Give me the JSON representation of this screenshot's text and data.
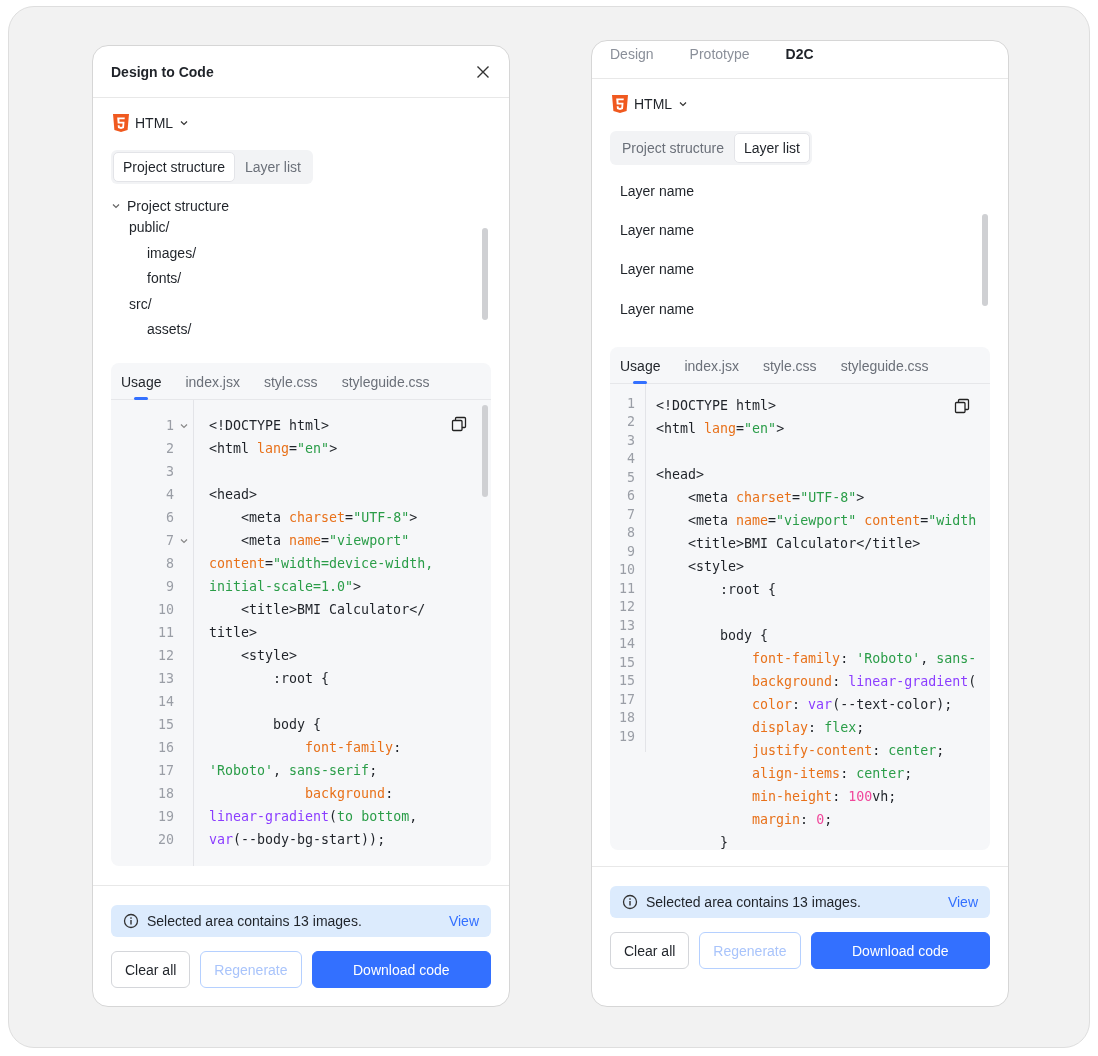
{
  "panels": [
    {
      "kind": "dialog",
      "title": "Design to Code",
      "language": "HTML",
      "segments": [
        {
          "label": "Project structure",
          "selected": true
        },
        {
          "label": "Layer list",
          "selected": false
        }
      ],
      "tree": {
        "label": "Project structure",
        "expanded": true,
        "children": [
          {
            "label": "public/",
            "children": [
              {
                "label": "images/"
              },
              {
                "label": "fonts/"
              }
            ]
          },
          {
            "label": "src/",
            "children": [
              {
                "label": "assets/"
              }
            ]
          }
        ]
      },
      "file_tabs": [
        {
          "label": "Usage",
          "selected": true
        },
        {
          "label": "index.jsx",
          "selected": false
        },
        {
          "label": "style.css",
          "selected": false
        },
        {
          "label": "styleguide.css",
          "selected": false
        }
      ],
      "rows": [
        {
          "number": "1",
          "foldable": true,
          "tokens": [
            {
              "kind": "plain",
              "text": "<!DOCTYPE html>"
            }
          ]
        },
        {
          "number": "2",
          "foldable": false,
          "tokens": [
            {
              "kind": "plain",
              "text": "<html "
            },
            {
              "kind": "attr",
              "text": "lang"
            },
            {
              "kind": "plain",
              "text": "="
            },
            {
              "kind": "string",
              "text": "\"en\""
            },
            {
              "kind": "plain",
              "text": ">"
            }
          ]
        },
        {
          "number": "3",
          "foldable": false
        },
        {
          "number": "4",
          "foldable": false,
          "tokens": [
            {
              "kind": "plain",
              "text": "<head>"
            }
          ]
        },
        {
          "number": "6",
          "foldable": false,
          "tokens": [
            {
              "kind": "plain",
              "text": "    <meta "
            },
            {
              "kind": "attr",
              "text": "charset"
            },
            {
              "kind": "plain",
              "text": "="
            },
            {
              "kind": "string",
              "text": "\"UTF-8\""
            },
            {
              "kind": "plain",
              "text": ">"
            }
          ]
        },
        {
          "number": "7",
          "foldable": true,
          "tokens": [
            {
              "kind": "plain",
              "text": "    <meta "
            },
            {
              "kind": "attr",
              "text": "name"
            },
            {
              "kind": "plain",
              "text": "="
            },
            {
              "kind": "string",
              "text": "\"viewport\""
            }
          ]
        },
        {
          "number": "8",
          "foldable": false,
          "tokens": [
            {
              "kind": "attr",
              "text": "content"
            },
            {
              "kind": "plain",
              "text": "="
            },
            {
              "kind": "string",
              "text": "\"width=device-width,"
            }
          ]
        },
        {
          "number": "9",
          "foldable": false,
          "tokens": [
            {
              "kind": "string",
              "text": "initial-scale=1.0\""
            },
            {
              "kind": "plain",
              "text": ">"
            }
          ]
        },
        {
          "number": "10",
          "foldable": false,
          "tokens": [
            {
              "kind": "plain",
              "text": "    <title>BMI Calculator</"
            }
          ]
        },
        {
          "number": "11",
          "foldable": false,
          "tokens": [
            {
              "kind": "plain",
              "text": "title>"
            }
          ]
        },
        {
          "number": "12",
          "foldable": false,
          "tokens": [
            {
              "kind": "plain",
              "text": "    <style>"
            }
          ]
        },
        {
          "number": "13",
          "foldable": false,
          "tokens": [
            {
              "kind": "plain",
              "text": "        :root {"
            }
          ]
        },
        {
          "number": "14",
          "foldable": false
        },
        {
          "number": "15",
          "foldable": false,
          "tokens": [
            {
              "kind": "plain",
              "text": "        body {"
            }
          ]
        },
        {
          "number": "16",
          "foldable": false,
          "tokens": [
            {
              "kind": "attr",
              "text": "            font-family"
            },
            {
              "kind": "plain",
              "text": ":"
            }
          ]
        },
        {
          "number": "17",
          "foldable": false,
          "tokens": [
            {
              "kind": "string",
              "text": "'Roboto'"
            },
            {
              "kind": "plain",
              "text": ", "
            },
            {
              "kind": "string",
              "text": "sans-serif"
            },
            {
              "kind": "plain",
              "text": ";"
            }
          ]
        },
        {
          "number": "18",
          "foldable": false,
          "tokens": [
            {
              "kind": "attr",
              "text": "            background"
            },
            {
              "kind": "plain",
              "text": ":"
            }
          ]
        },
        {
          "number": "19",
          "foldable": false,
          "tokens": [
            {
              "kind": "func",
              "text": "linear-gradient"
            },
            {
              "kind": "plain",
              "text": "("
            },
            {
              "kind": "string",
              "text": "to bottom"
            },
            {
              "kind": "plain",
              "text": ","
            }
          ]
        },
        {
          "number": "20",
          "foldable": false,
          "tokens": [
            {
              "kind": "func",
              "text": "var"
            },
            {
              "kind": "plain",
              "text": "(--body-bg-start));"
            }
          ]
        }
      ],
      "notice": {
        "text": "Selected area contains 13 images.",
        "link": "View"
      },
      "buttons": [
        {
          "label": "Clear all",
          "kind": "secondary",
          "disabled": false
        },
        {
          "label": "Regenerate",
          "kind": "secondary",
          "disabled": true
        },
        {
          "label": "Download code",
          "kind": "primary",
          "disabled": false
        }
      ]
    },
    {
      "kind": "sidebar",
      "tabs": [
        {
          "label": "Design",
          "selected": false
        },
        {
          "label": "Prototype",
          "selected": false
        },
        {
          "label": "D2C",
          "selected": true
        }
      ],
      "language": "HTML",
      "segments": [
        {
          "label": "Project structure",
          "selected": false
        },
        {
          "label": "Layer list",
          "selected": true
        }
      ],
      "layers": [
        "Layer name",
        "Layer name",
        "Layer name",
        "Layer name"
      ],
      "file_tabs": [
        {
          "label": "Usage",
          "selected": true
        },
        {
          "label": "index.jsx",
          "selected": false
        },
        {
          "label": "style.css",
          "selected": false
        },
        {
          "label": "styleguide.css",
          "selected": false
        }
      ],
      "rows": [
        {
          "number": "1",
          "tokens": [
            {
              "kind": "plain",
              "text": "<!DOCTYPE html>"
            }
          ]
        },
        {
          "number": "2",
          "tokens": [
            {
              "kind": "plain",
              "text": "<html "
            },
            {
              "kind": "attr",
              "text": "lang"
            },
            {
              "kind": "plain",
              "text": "="
            },
            {
              "kind": "string",
              "text": "\"en\""
            },
            {
              "kind": "plain",
              "text": ">"
            }
          ]
        },
        {
          "number": "3"
        },
        {
          "number": "4",
          "tokens": [
            {
              "kind": "plain",
              "text": "<head>"
            }
          ]
        },
        {
          "number": "5",
          "tokens": [
            {
              "kind": "plain",
              "text": "    <meta "
            },
            {
              "kind": "attr",
              "text": "charset"
            },
            {
              "kind": "plain",
              "text": "="
            },
            {
              "kind": "string",
              "text": "\"UTF-8\""
            },
            {
              "kind": "plain",
              "text": ">"
            }
          ]
        },
        {
          "number": "6",
          "tokens": [
            {
              "kind": "plain",
              "text": "    <meta "
            },
            {
              "kind": "attr",
              "text": "name"
            },
            {
              "kind": "plain",
              "text": "="
            },
            {
              "kind": "string",
              "text": "\"viewport\""
            },
            {
              "kind": "attr",
              "text": " content"
            },
            {
              "kind": "plain",
              "text": "="
            },
            {
              "kind": "string",
              "text": "\"width"
            }
          ]
        },
        {
          "number": "7",
          "tokens": [
            {
              "kind": "plain",
              "text": "    <title>BMI Calculator</title>"
            }
          ]
        },
        {
          "number": "8",
          "tokens": [
            {
              "kind": "plain",
              "text": "    <style>"
            }
          ]
        },
        {
          "number": "9",
          "tokens": [
            {
              "kind": "plain",
              "text": "        :root {"
            }
          ]
        },
        {
          "number": "10"
        },
        {
          "number": "11",
          "tokens": [
            {
              "kind": "plain",
              "text": "        body {"
            }
          ]
        },
        {
          "number": "12",
          "tokens": [
            {
              "kind": "attr",
              "text": "            font-family"
            },
            {
              "kind": "plain",
              "text": ": "
            },
            {
              "kind": "string",
              "text": "'Roboto'"
            },
            {
              "kind": "plain",
              "text": ", "
            },
            {
              "kind": "string",
              "text": "sans-"
            }
          ]
        },
        {
          "number": "13",
          "tokens": [
            {
              "kind": "attr",
              "text": "            background"
            },
            {
              "kind": "plain",
              "text": ": "
            },
            {
              "kind": "func",
              "text": "linear-gradient"
            },
            {
              "kind": "plain",
              "text": "("
            }
          ]
        },
        {
          "number": "14",
          "tokens": [
            {
              "kind": "attr",
              "text": "            color"
            },
            {
              "kind": "plain",
              "text": ": "
            },
            {
              "kind": "func",
              "text": "var"
            },
            {
              "kind": "plain",
              "text": "(--text-color);"
            }
          ]
        },
        {
          "number": "15",
          "tokens": [
            {
              "kind": "attr",
              "text": "            display"
            },
            {
              "kind": "plain",
              "text": ": "
            },
            {
              "kind": "string",
              "text": "flex"
            },
            {
              "kind": "plain",
              "text": ";"
            }
          ]
        },
        {
          "number": "15",
          "tokens": [
            {
              "kind": "attr",
              "text": "            justify-content"
            },
            {
              "kind": "plain",
              "text": ": "
            },
            {
              "kind": "string",
              "text": "center"
            },
            {
              "kind": "plain",
              "text": ";"
            }
          ]
        },
        {
          "number": "17",
          "tokens": [
            {
              "kind": "attr",
              "text": "            align-items"
            },
            {
              "kind": "plain",
              "text": ": "
            },
            {
              "kind": "string",
              "text": "center"
            },
            {
              "kind": "plain",
              "text": ";"
            }
          ]
        },
        {
          "number": "18",
          "tokens": [
            {
              "kind": "attr",
              "text": "            min-height"
            },
            {
              "kind": "plain",
              "text": ": "
            },
            {
              "kind": "number",
              "text": "100"
            },
            {
              "kind": "plain",
              "text": "vh;"
            }
          ]
        },
        {
          "number": "19",
          "tokens": [
            {
              "kind": "attr",
              "text": "            margin"
            },
            {
              "kind": "plain",
              "text": ": "
            },
            {
              "kind": "number",
              "text": "0"
            },
            {
              "kind": "plain",
              "text": ";"
            }
          ]
        },
        {
          "tokens": [
            {
              "kind": "plain",
              "text": "        }"
            }
          ]
        }
      ],
      "notice": {
        "text": "Selected area contains 13 images.",
        "link": "View"
      },
      "buttons": [
        {
          "label": "Clear all",
          "kind": "secondary",
          "disabled": false
        },
        {
          "label": "Regenerate",
          "kind": "secondary",
          "disabled": true
        },
        {
          "label": "Download code",
          "kind": "primary",
          "disabled": false
        }
      ]
    }
  ]
}
